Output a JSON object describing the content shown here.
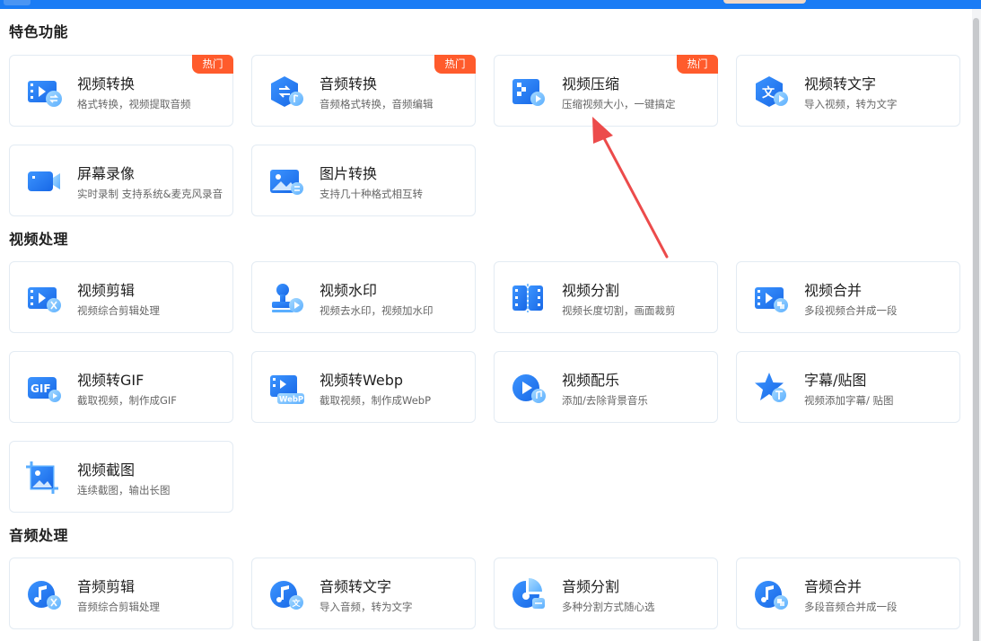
{
  "sections": {
    "featured": {
      "title": "特色功能",
      "items": [
        {
          "name": "视频转换",
          "desc": "格式转换，视频提取音频",
          "badge": "热门"
        },
        {
          "name": "音频转换",
          "desc": "音频格式转换，音频编辑",
          "badge": "热门"
        },
        {
          "name": "视频压缩",
          "desc": "压缩视频大小，一键搞定",
          "badge": "热门"
        },
        {
          "name": "视频转文字",
          "desc": "导入视频，转为文字"
        },
        {
          "name": "屏幕录像",
          "desc": "实时录制 支持系统&麦克风录音"
        },
        {
          "name": "图片转换",
          "desc": "支持几十种格式相互转"
        }
      ]
    },
    "video": {
      "title": "视频处理",
      "items": [
        {
          "name": "视频剪辑",
          "desc": "视频综合剪辑处理"
        },
        {
          "name": "视频水印",
          "desc": "视频去水印，视频加水印"
        },
        {
          "name": "视频分割",
          "desc": "视频长度切割，画面裁剪"
        },
        {
          "name": "视频合并",
          "desc": "多段视频合并成一段"
        },
        {
          "name": "视频转GIF",
          "desc": "截取视频，制作成GIF",
          "icon_text": "GIF"
        },
        {
          "name": "视频转Webp",
          "desc": "截取视频，制作成WebP",
          "icon_text": "WebP"
        },
        {
          "name": "视频配乐",
          "desc": "添加/去除背景音乐"
        },
        {
          "name": "字幕/贴图",
          "desc": "视频添加字幕/ 贴图"
        },
        {
          "name": "视频截图",
          "desc": "连续截图，输出长图"
        }
      ]
    },
    "audio": {
      "title": "音频处理",
      "items": [
        {
          "name": "音频剪辑",
          "desc": "音频综合剪辑处理"
        },
        {
          "name": "音频转文字",
          "desc": "导入音频，转为文字"
        },
        {
          "name": "音频分割",
          "desc": "多种分割方式随心选"
        },
        {
          "name": "音频合并",
          "desc": "多段音频合并成一段"
        }
      ]
    }
  },
  "icons": {
    "video_convert": "film-convert-icon",
    "audio_convert": "hexagon-convert-icon",
    "video_compress": "compress-icon",
    "video_to_text": "text-hexagon-icon",
    "screen_record": "camera-icon",
    "image_convert": "image-icon",
    "video_edit": "film-scissors-icon",
    "video_watermark": "stamp-icon",
    "video_split": "film-split-icon",
    "video_merge": "film-merge-icon",
    "video_gif": "gif-icon",
    "video_webp": "webp-icon",
    "video_music": "play-music-icon",
    "subtitle": "star-text-icon",
    "video_screenshot": "crop-image-icon",
    "audio_edit": "music-scissors-icon",
    "audio_to_text": "music-text-icon",
    "audio_split": "pie-split-icon",
    "audio_merge": "music-merge-icon"
  },
  "colors": {
    "accent": "#1a7cf5",
    "badge": "#ff5b2c",
    "icon_dark": "#1e78ef",
    "icon_light": "#7cc0ff",
    "annotation_arrow": "#ec4b4b"
  }
}
